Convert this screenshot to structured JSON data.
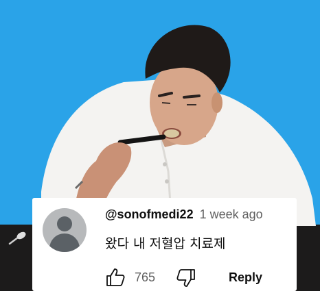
{
  "comment": {
    "author": "@sonofmedi22",
    "timestamp": "1 week ago",
    "text": "왔다 내 저혈압 치료제",
    "likes": "765",
    "reply_label": "Reply",
    "avatar_icon": "default-avatar-icon",
    "like_icon": "thumbs-up-icon",
    "dislike_icon": "thumbs-down-icon"
  },
  "colors": {
    "background": "#2aa3e8",
    "card": "#ffffff",
    "text_primary": "#0f0f0f",
    "text_secondary": "#5f5f5f"
  }
}
